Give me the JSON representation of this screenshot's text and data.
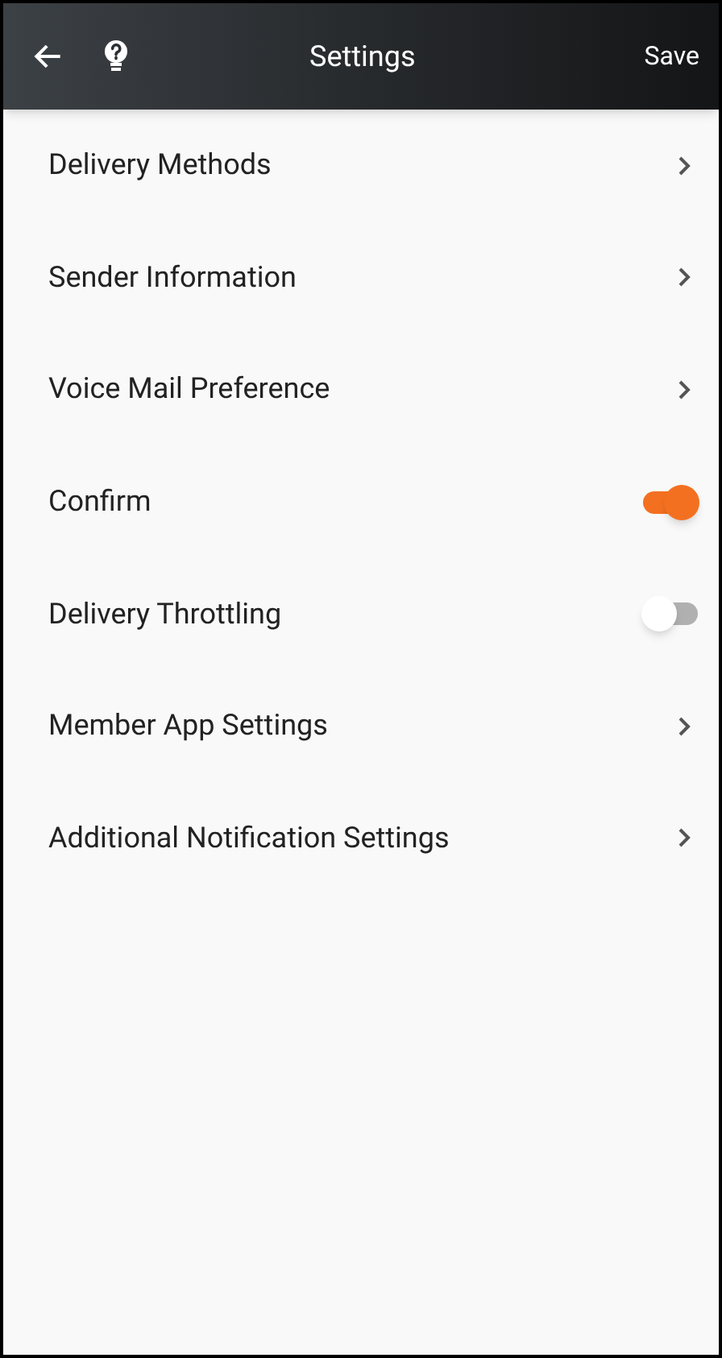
{
  "header": {
    "title": "Settings",
    "action": "Save"
  },
  "items": [
    {
      "label": "Delivery Methods",
      "kind": "link"
    },
    {
      "label": "Sender Information",
      "kind": "link"
    },
    {
      "label": "Voice Mail Preference",
      "kind": "link"
    },
    {
      "label": "Confirm",
      "kind": "toggle",
      "on": true
    },
    {
      "label": "Delivery Throttling",
      "kind": "toggle",
      "on": false
    },
    {
      "label": "Member App Settings",
      "kind": "link"
    },
    {
      "label": "Additional Notification Settings",
      "kind": "link"
    }
  ]
}
